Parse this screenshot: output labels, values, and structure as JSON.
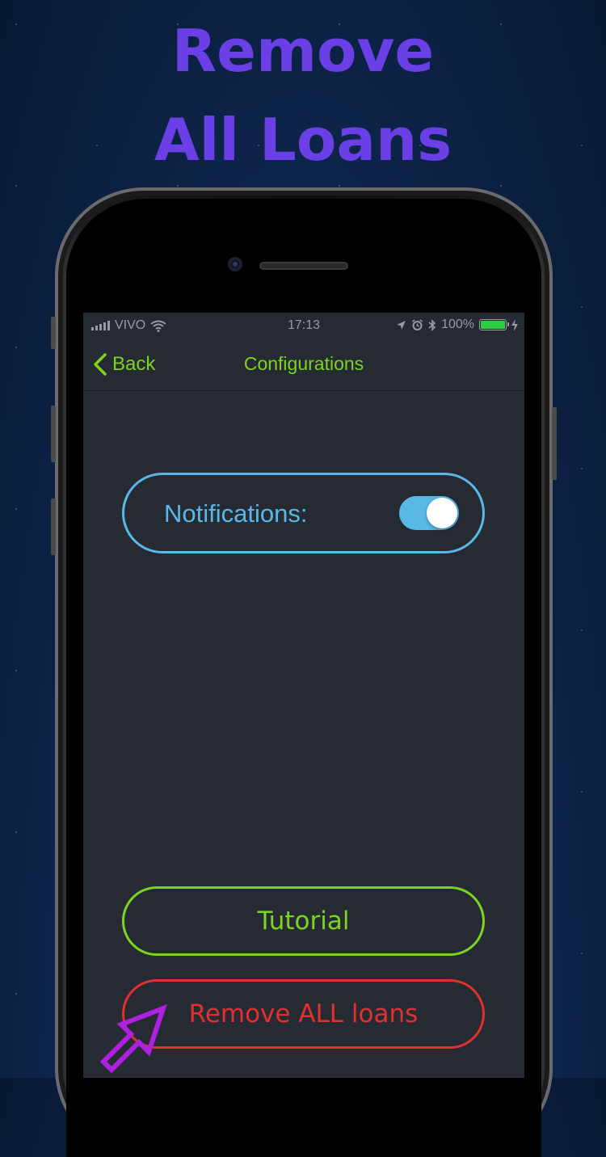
{
  "promo": {
    "line1": "Remove",
    "line2": "All Loans"
  },
  "status_bar": {
    "carrier": "VIVO",
    "time": "17:13",
    "battery_percent": "100%",
    "battery_level": 1.0
  },
  "nav": {
    "back_label": "Back",
    "title": "Configurations"
  },
  "settings": {
    "notifications_label": "Notifications:",
    "notifications_enabled": true
  },
  "buttons": {
    "tutorial": "Tutorial",
    "remove_all": "Remove ALL loans"
  },
  "colors": {
    "promo_title": "#6a3fe6",
    "accent_green": "#7ed321",
    "accent_blue": "#5ab8e6",
    "danger_red": "#e03030",
    "screen_bg": "#262a33",
    "pointer_purple": "#b020e0"
  },
  "icons": {
    "back": "chevron-left-icon",
    "wifi": "wifi-icon",
    "location": "location-arrow-icon",
    "alarm": "alarm-icon",
    "bluetooth": "bluetooth-icon",
    "charging": "lightning-icon",
    "pointer": "arrow-pointer-icon"
  }
}
